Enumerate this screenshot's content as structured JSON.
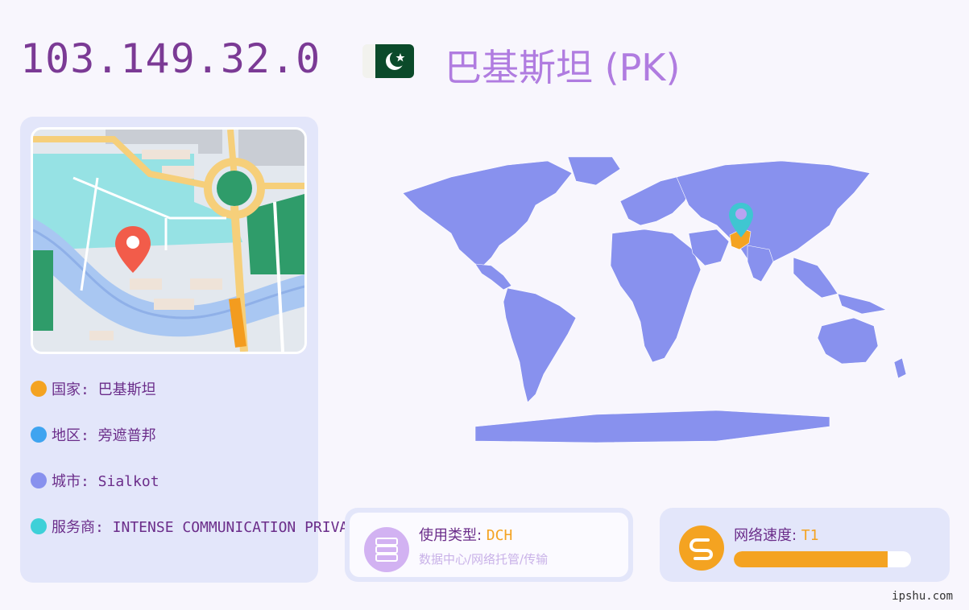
{
  "header": {
    "ip_address": "103.149.32.0",
    "country_title": "巴基斯坦 (PK)"
  },
  "info": {
    "country": "国家: 巴基斯坦",
    "region": "地区: 旁遮普邦",
    "city": "城市: Sialkot",
    "isp": "服务商: INTENSE COMMUNICATION PRIVATE LIMITED."
  },
  "usage_type": {
    "label": "使用类型: ",
    "value": "DCH",
    "description": "数据中心/网络托管/传输"
  },
  "network_speed": {
    "label": "网络速度: ",
    "value": "T1",
    "progress_fraction": 0.87
  },
  "footer": {
    "site": "ipshu.com"
  },
  "colors": {
    "accent_purple": "#7b3a95",
    "title_lilac": "#b07ce0",
    "map_fill": "#8891ee",
    "highlight_orange": "#f4a321",
    "marker_teal": "#3fc6d1",
    "dot_country": "#f4a321",
    "dot_region": "#3fa4f0",
    "dot_city": "#8891ee",
    "dot_isp": "#3ed0d8"
  },
  "icons": {
    "flag": "pakistan-flag",
    "location_pin": "map-pin-icon",
    "server": "server-icon",
    "speed": "speed-icon"
  }
}
